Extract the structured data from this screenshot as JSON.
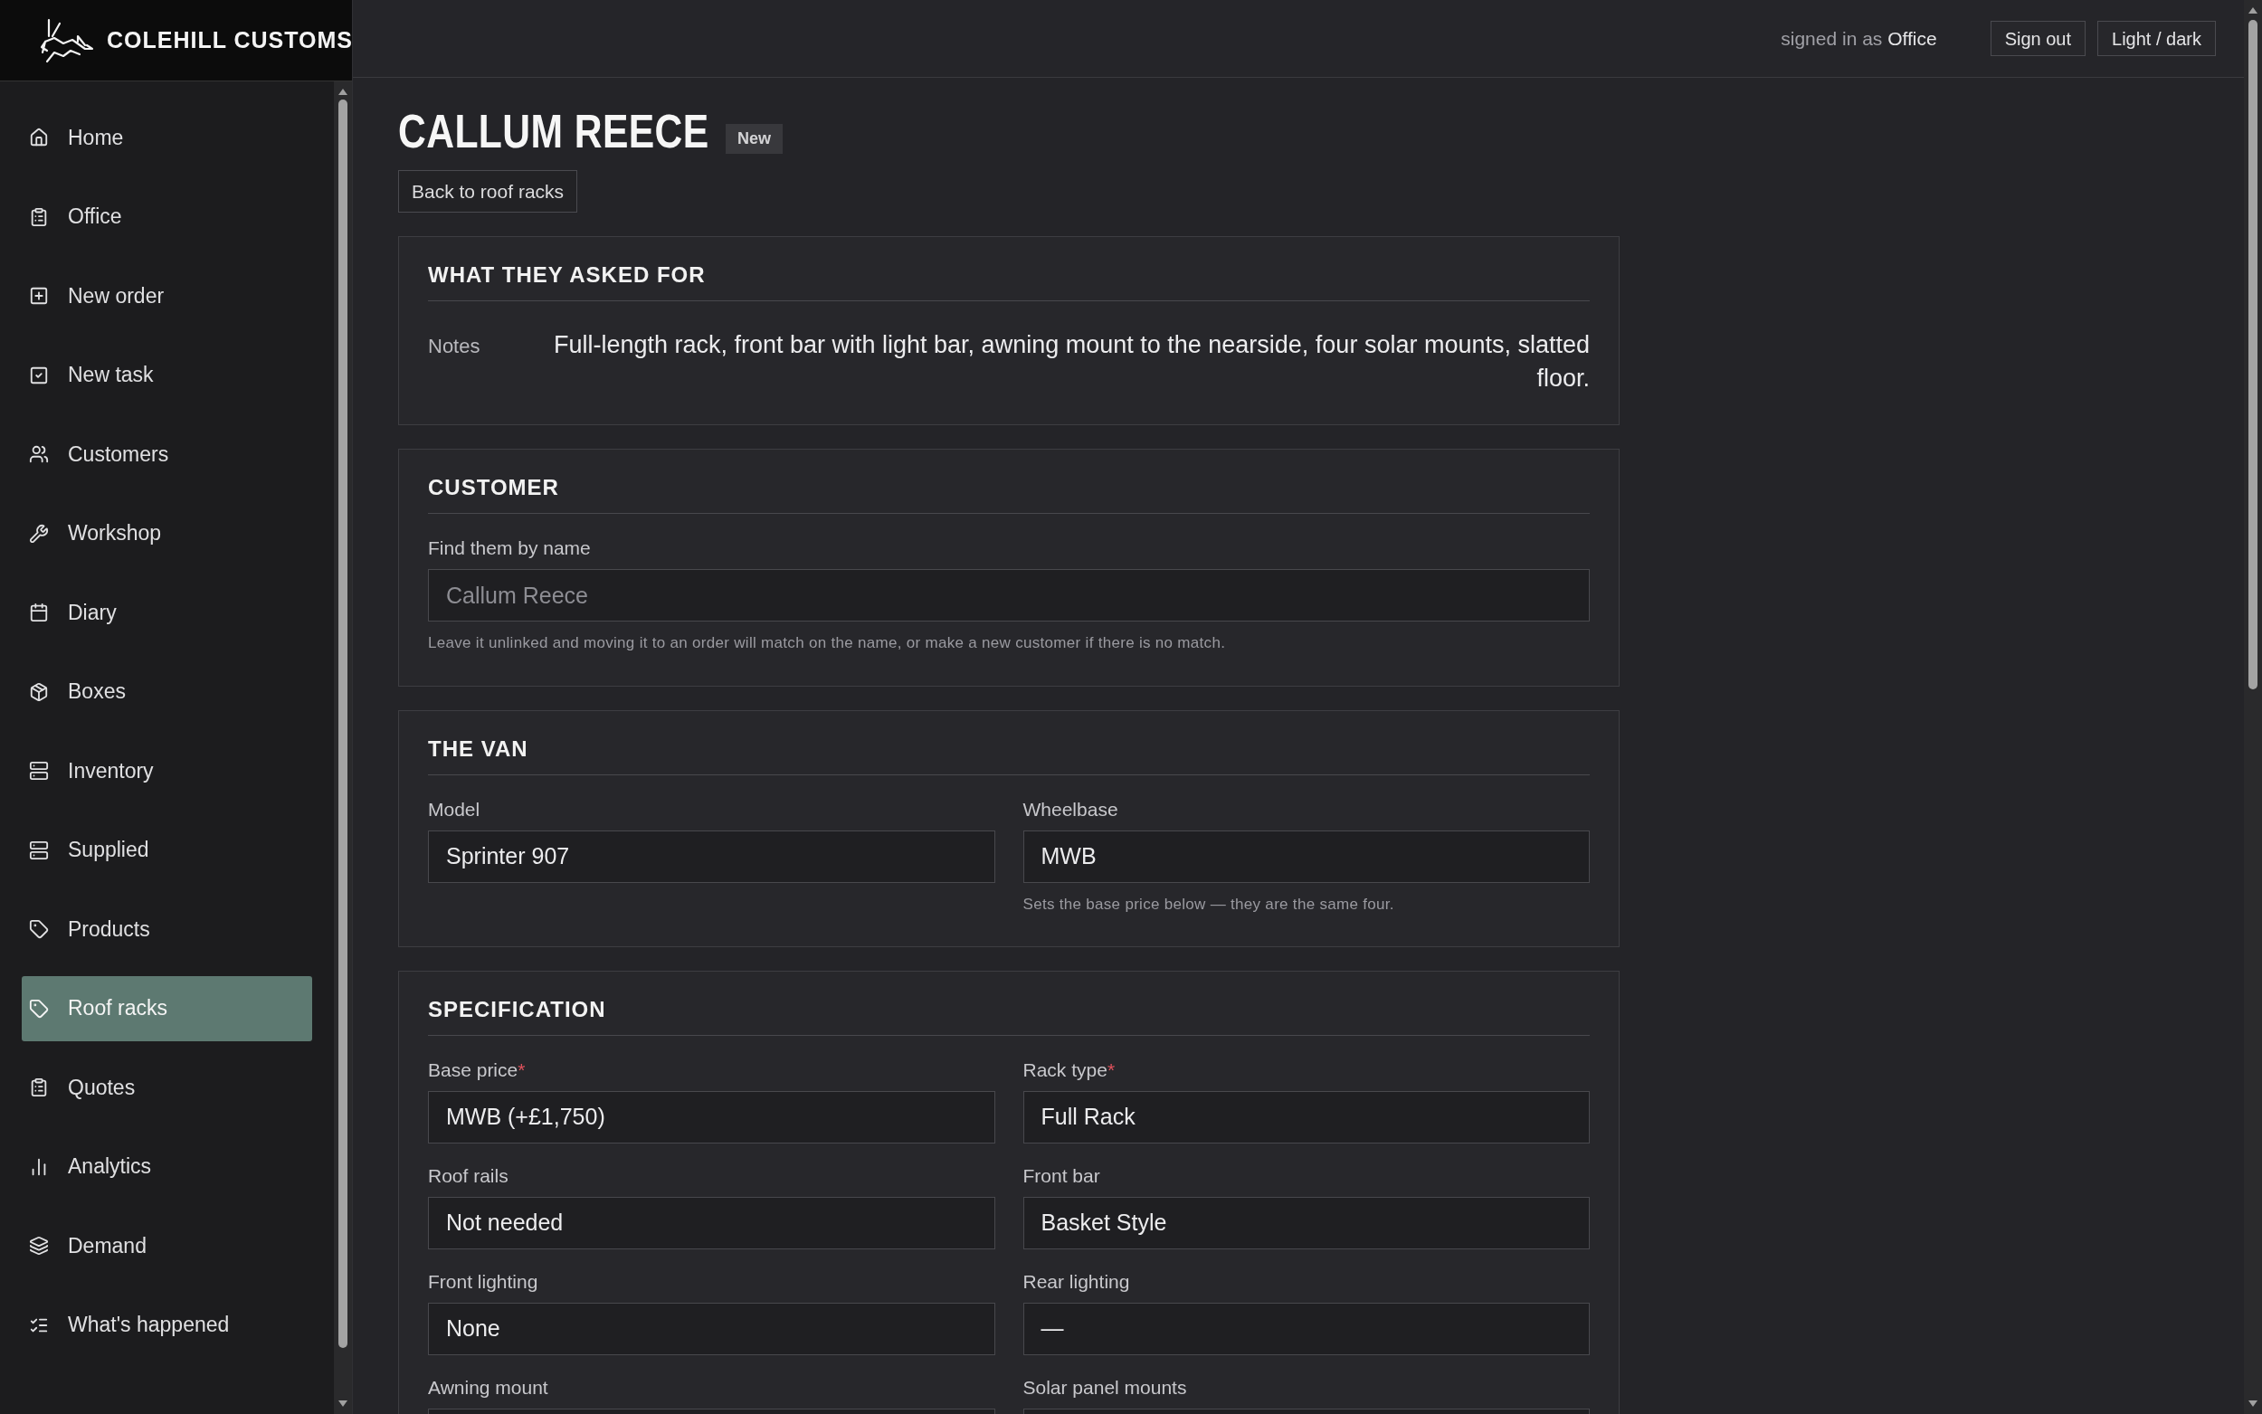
{
  "brand": {
    "name": "COLEHILL CUSTOMS"
  },
  "sidebar": {
    "items": [
      {
        "label": "Home",
        "selected": false
      },
      {
        "label": "Office",
        "selected": false
      },
      {
        "label": "New order",
        "selected": false
      },
      {
        "label": "New task",
        "selected": false
      },
      {
        "label": "Customers",
        "selected": false
      },
      {
        "label": "Workshop",
        "selected": false
      },
      {
        "label": "Diary",
        "selected": false
      },
      {
        "label": "Boxes",
        "selected": false
      },
      {
        "label": "Inventory",
        "selected": false
      },
      {
        "label": "Supplied",
        "selected": false
      },
      {
        "label": "Products",
        "selected": false
      },
      {
        "label": "Roof racks",
        "selected": true
      },
      {
        "label": "Quotes",
        "selected": false
      },
      {
        "label": "Analytics",
        "selected": false
      },
      {
        "label": "Demand",
        "selected": false
      },
      {
        "label": "What's happened",
        "selected": false
      }
    ]
  },
  "header": {
    "signed_in_label": "signed in as",
    "user": "Office",
    "buttons": [
      "Sign out",
      "Light / dark"
    ]
  },
  "page": {
    "title": "CALLUM REECE",
    "badge": "New",
    "back_button": "Back to roof racks"
  },
  "sections": [
    {
      "kind": "notes",
      "title": "WHAT THEY ASKED FOR",
      "label": "Notes",
      "text": "Full-length rack, front bar with light bar, awning mount to the nearside, four solar mounts, slatted floor."
    },
    {
      "kind": "search",
      "title": "CUSTOMER",
      "label": "Find them by name",
      "placeholder": "Callum Reece",
      "hint": "Leave it unlinked and moving it to an order will match on the name, or make a new customer if there is no match."
    },
    {
      "kind": "grid",
      "title": "THE VAN",
      "fields": [
        {
          "label": "Model",
          "value": "Sprinter 907"
        },
        {
          "label": "Wheelbase",
          "value": "MWB",
          "hint": "Sets the base price below — they are the same four."
        }
      ]
    },
    {
      "kind": "grid",
      "title": "SPECIFICATION",
      "fields": [
        {
          "label": "Base price",
          "value": "MWB (+£1,750)",
          "required_mark": "*"
        },
        {
          "label": "Rack type",
          "value": "Full Rack",
          "required_mark": "*"
        },
        {
          "label": "Roof rails",
          "value": "Not needed"
        },
        {
          "label": "Front bar",
          "value": "Basket Style"
        },
        {
          "label": "Front lighting",
          "value": "None"
        },
        {
          "label": "Rear lighting",
          "value": "—"
        },
        {
          "label": "Awning mount"
        },
        {
          "label": "Solar panel mounts"
        }
      ]
    }
  ]
}
